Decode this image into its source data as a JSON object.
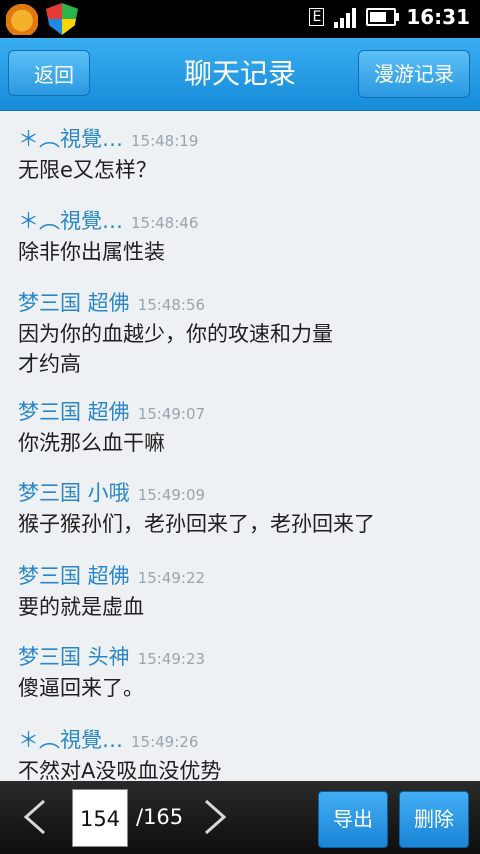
{
  "status_bar": {
    "time": "16:31",
    "network": "E"
  },
  "header": {
    "title": "聊天记录",
    "back_label": "返回",
    "roam_label": "漫游记录"
  },
  "messages": [
    {
      "sender": "＊︵視覺…",
      "time": "15:48:19",
      "lines": [
        "无限e又怎样？"
      ]
    },
    {
      "sender": "＊︵視覺…",
      "time": "15:48:46",
      "lines": [
        "除非你出属性装"
      ]
    },
    {
      "sender": "梦三国 超佛",
      "time": "15:48:56",
      "lines": [
        "因为你的血越少，你的攻速和力量",
        "才约高"
      ]
    },
    {
      "sender": "梦三国 超佛",
      "time": "15:49:07",
      "lines": [
        "你洗那么血干嘛"
      ]
    },
    {
      "sender": "梦三国 小哦",
      "time": "15:49:09",
      "lines": [
        "猴子猴孙们，老孙回来了，老孙回来了"
      ]
    },
    {
      "sender": "梦三国 超佛",
      "time": "15:49:22",
      "lines": [
        "要的就是虚血"
      ]
    },
    {
      "sender": "梦三国 头神",
      "time": "15:49:23",
      "lines": [
        "傻逼回来了。"
      ]
    },
    {
      "sender": "＊︵視覺…",
      "time": "15:49:26",
      "lines": [
        "不然对A没吸血没优势"
      ]
    }
  ],
  "pager": {
    "current_page": "154",
    "total": "/165"
  },
  "actions": {
    "export_label": "导出",
    "delete_label": "删除"
  }
}
